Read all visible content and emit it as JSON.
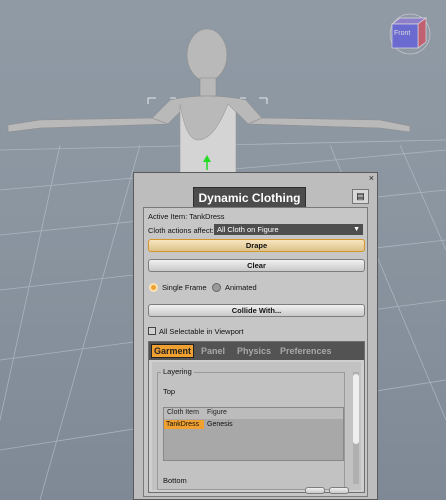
{
  "viewport": {
    "cube_label": "Front"
  },
  "panel": {
    "title": "Dynamic Clothing",
    "close": "×",
    "menu": "▤",
    "active_item_label": "Active Item: TankDress",
    "affect_label": "Cloth actions affect:",
    "affect_value": "All Cloth on Figure",
    "drape_label": "Drape",
    "clear_label": "Clear",
    "single_frame_label": "Single Frame",
    "animated_label": "Animated",
    "collide_label": "Collide With...",
    "selectable_label": "All Selectable in Viewport",
    "tabs": [
      "Garment",
      "Panel",
      "Physics",
      "Preferences"
    ],
    "layering": {
      "title": "Layering",
      "top": "Top",
      "columns": [
        "Cloth Item",
        "Figure"
      ],
      "rows": [
        {
          "item": "TankDress",
          "figure": "Genesis"
        }
      ],
      "bottom": "Bottom"
    }
  }
}
